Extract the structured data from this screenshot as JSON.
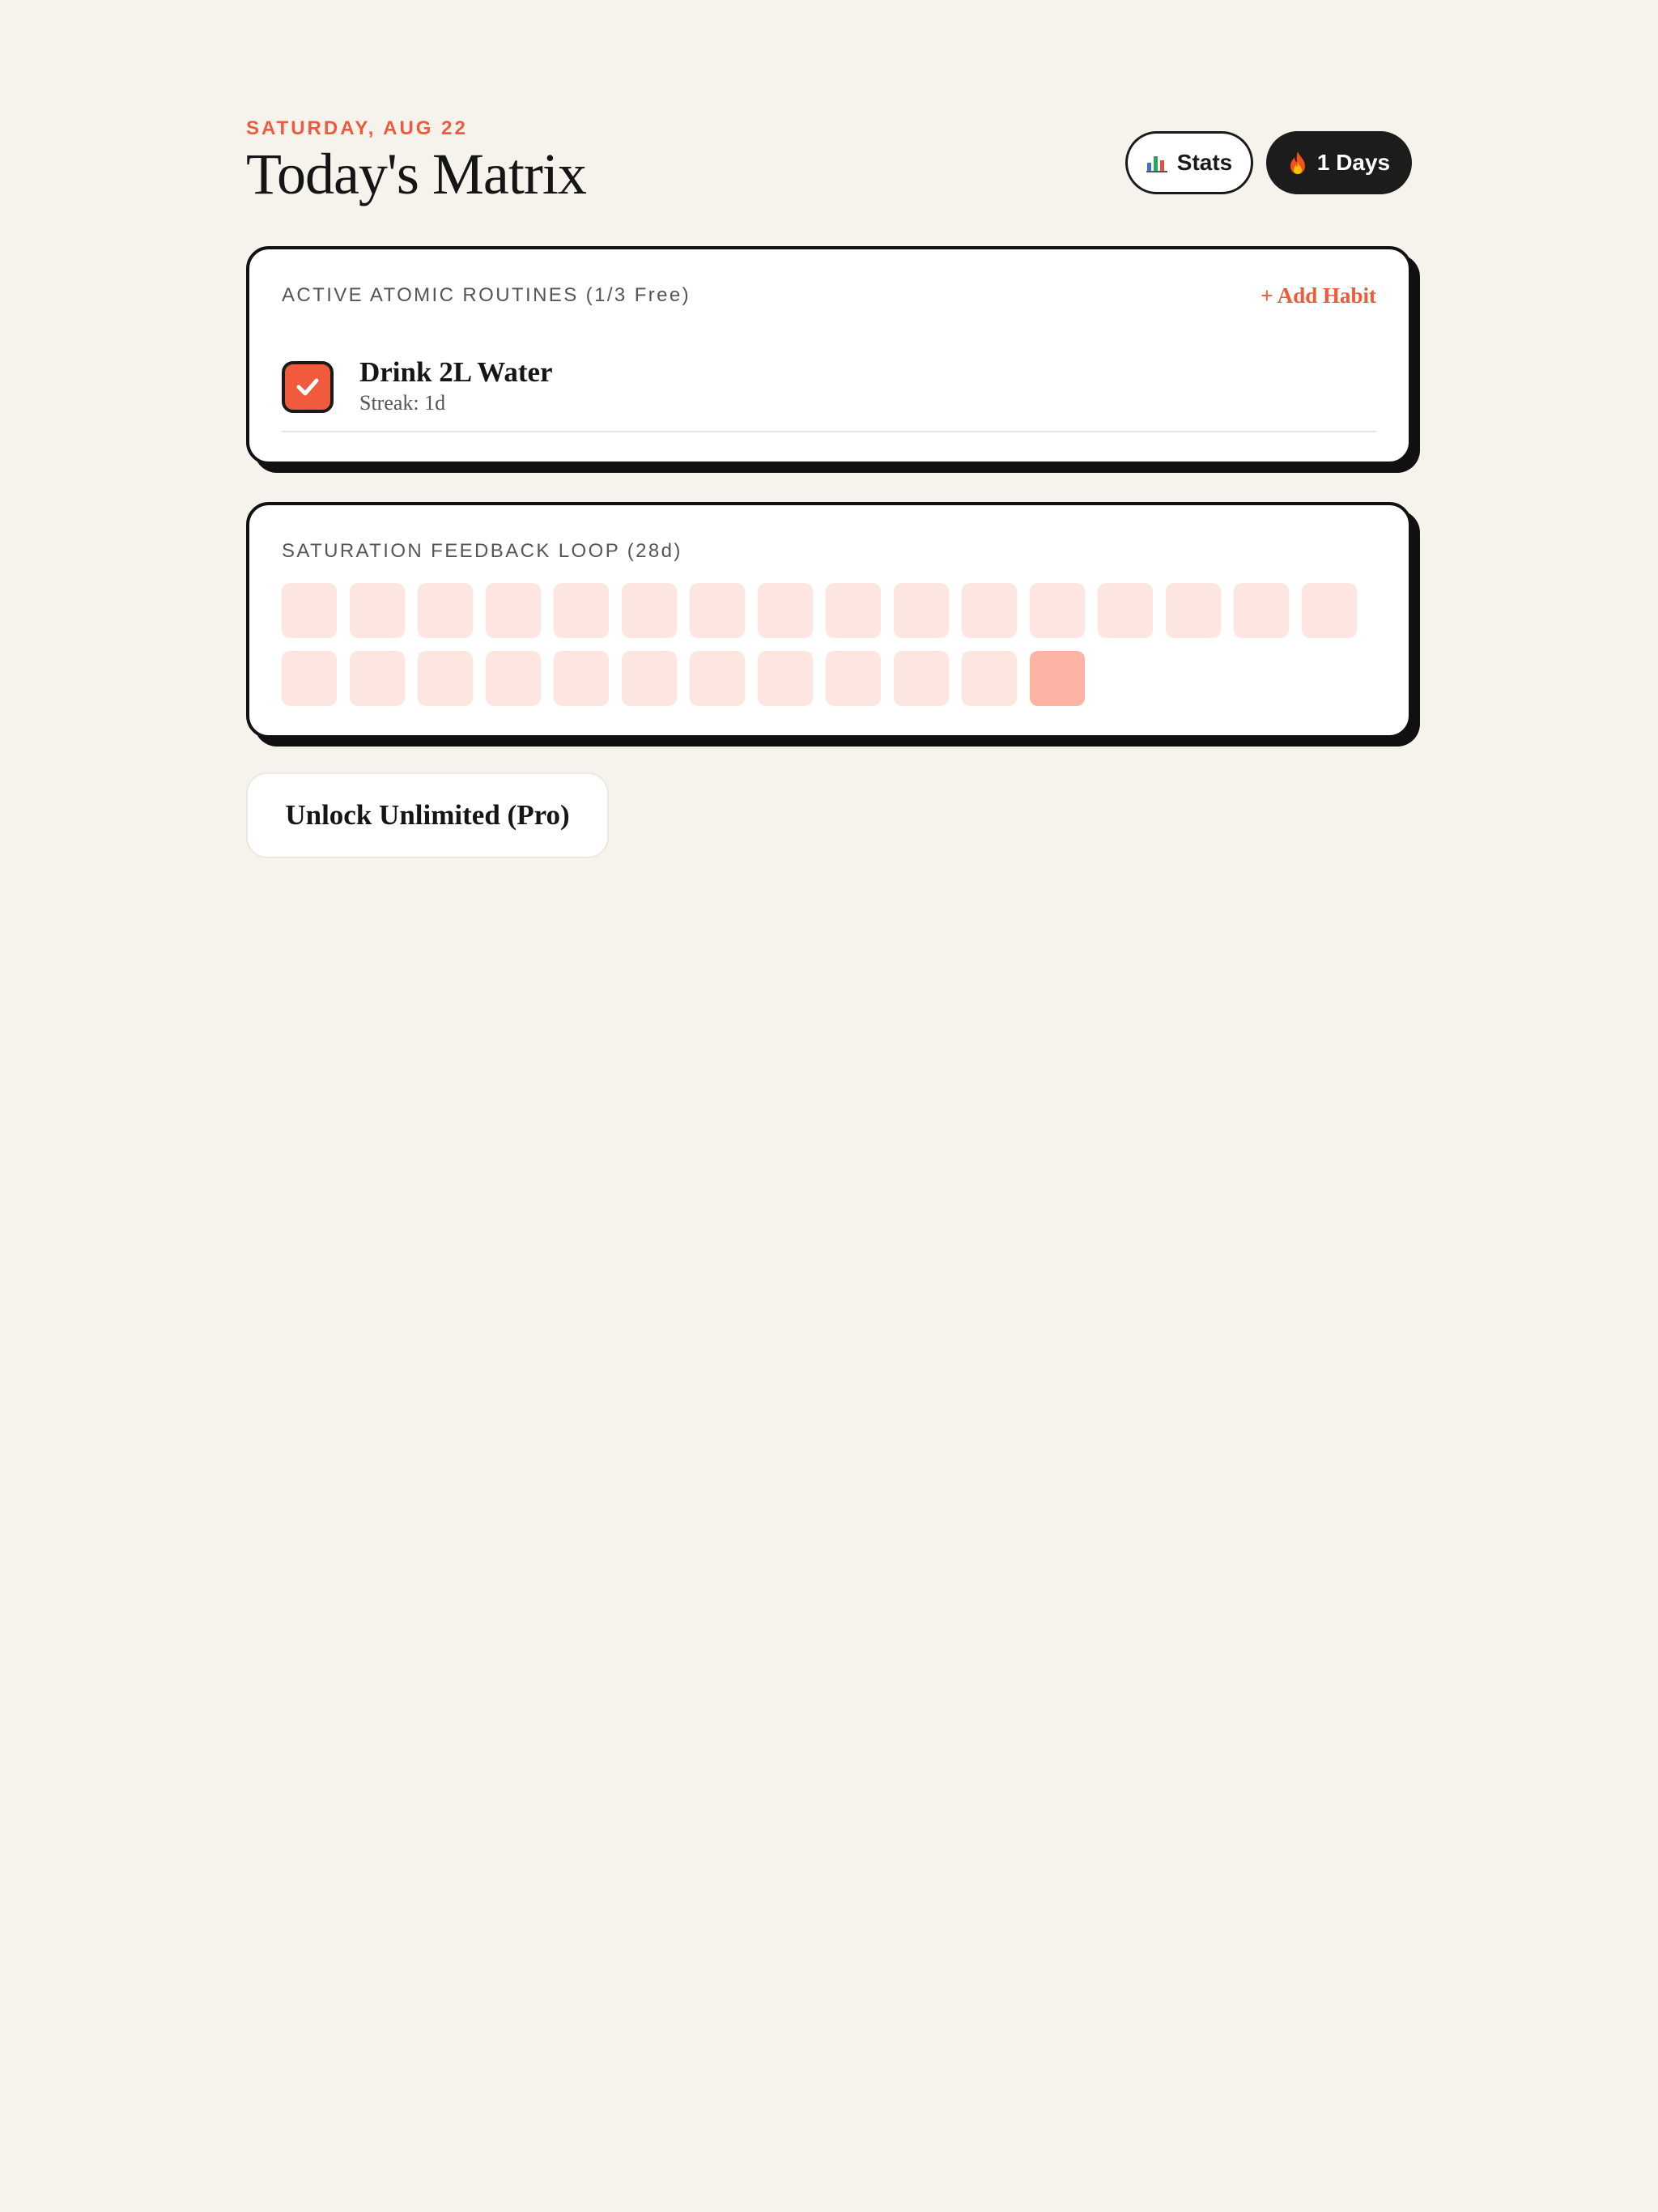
{
  "header": {
    "date": "SATURDAY, AUG 22",
    "title": "Today's Matrix",
    "stats_label": "Stats",
    "streak_label": "1 Days",
    "stats_icon": "bar-chart-icon",
    "streak_icon": "fire-icon"
  },
  "habits_card": {
    "label": "ACTIVE ATOMIC ROUTINES (1/3 Free)",
    "add_label": "+ Add Habit",
    "items": [
      {
        "name": "Drink 2L Water",
        "streak": "Streak: 1d",
        "checked": true
      }
    ]
  },
  "matrix_card": {
    "label": "SATURATION FEEDBACK LOOP (28d)",
    "days": [
      0,
      0,
      0,
      0,
      0,
      0,
      0,
      0,
      0,
      0,
      0,
      0,
      0,
      0,
      0,
      0,
      0,
      0,
      0,
      0,
      0,
      0,
      0,
      0,
      0,
      0,
      0,
      1
    ],
    "colors": {
      "empty": "#fde6e0",
      "filled": "#fdb4a4"
    }
  },
  "pro": {
    "label": "Unlock Unlimited (Pro)"
  },
  "colors": {
    "background": "#f6f3ed",
    "accent": "#f05a3b",
    "ink": "#111111"
  }
}
